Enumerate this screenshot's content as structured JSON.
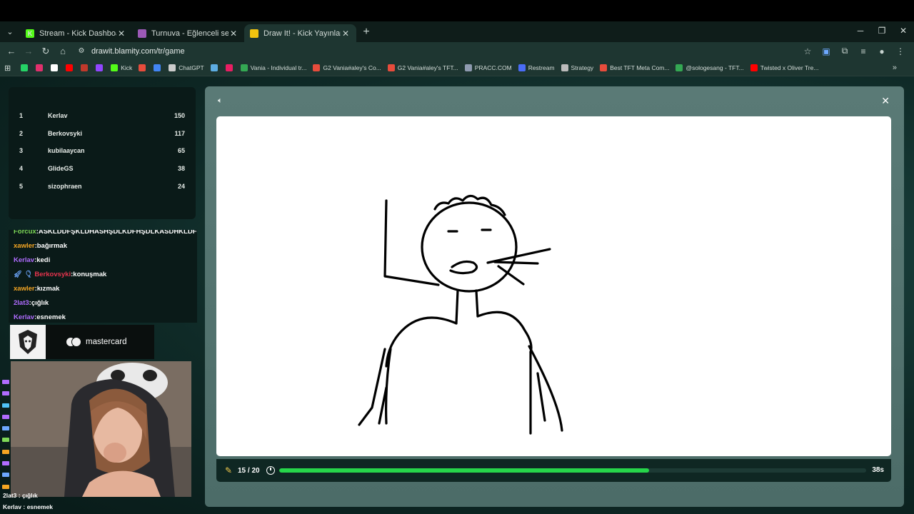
{
  "browser": {
    "tabs": [
      {
        "title": "Stream - Kick Dashboard",
        "active": false,
        "favicon_color": "#53fc18",
        "favicon_char": "K"
      },
      {
        "title": "Turnuva - Eğlenceli seçimler ya",
        "active": false,
        "favicon_color": "#9b59b6",
        "favicon_char": ""
      },
      {
        "title": "Draw It! - Kick Yayınları İçin Çiz",
        "active": true,
        "favicon_color": "#f1c40f",
        "favicon_char": ""
      }
    ],
    "url": "drawit.blamity.com/tr/game",
    "bookmarks": [
      {
        "label": "",
        "color": "#25d366"
      },
      {
        "label": "",
        "color": "#e1306c"
      },
      {
        "label": "",
        "color": "#ffffff"
      },
      {
        "label": "",
        "color": "#ff0000"
      },
      {
        "label": "",
        "color": "#c0392b"
      },
      {
        "label": "",
        "color": "#9146ff"
      },
      {
        "label": "Kick",
        "color": "#53fc18"
      },
      {
        "label": "",
        "color": "#e74c3c"
      },
      {
        "label": "",
        "color": "#4285f4"
      },
      {
        "label": "ChatGPT",
        "color": "#cccccc"
      },
      {
        "label": "",
        "color": "#5dade2"
      },
      {
        "label": "",
        "color": "#e91e63"
      },
      {
        "label": "Vania - Individual tr...",
        "color": "#34a853"
      },
      {
        "label": "G2 Vania#aley's Co...",
        "color": "#e74c3c"
      },
      {
        "label": "G2 Vania#aley's TFT...",
        "color": "#e74c3c"
      },
      {
        "label": "PRACC.COM",
        "color": "#8e9aaf"
      },
      {
        "label": "Restream",
        "color": "#4a6cf7"
      },
      {
        "label": "Strategy",
        "color": "#bbbbbb"
      },
      {
        "label": "Best TFT Meta Com...",
        "color": "#e74c3c"
      },
      {
        "label": "@sologesang - TFT...",
        "color": "#34a853"
      },
      {
        "label": "Twisted x Oliver Tre...",
        "color": "#ff0000"
      }
    ]
  },
  "leaderboard": [
    {
      "rank": "1",
      "name": "Kerlav",
      "score": "150"
    },
    {
      "rank": "2",
      "name": "Berkovsyki",
      "score": "117"
    },
    {
      "rank": "3",
      "name": "kubilaaycan",
      "score": "65"
    },
    {
      "rank": "4",
      "name": "GlideGS",
      "score": "38"
    },
    {
      "rank": "5",
      "name": "sizophraen",
      "score": "24"
    }
  ],
  "chat": [
    {
      "user": "Forcux",
      "sep": ":",
      "text": "ASKLDDFŞKLDHASHŞDLKDFHŞDLKASDHKLDF",
      "color": "#7ed957"
    },
    {
      "user": "xawler",
      "sep": ":",
      "text": "bağırmak",
      "color": "#f5a623"
    },
    {
      "user": "Kerlav",
      "sep": ":",
      "text": "kedi",
      "color": "#b06cff"
    },
    {
      "user": "Berkovsyki",
      "sep": ":",
      "text": "konuşmak",
      "color": "#e8344e"
    },
    {
      "user": "xawler",
      "sep": ":",
      "text": "kızmak",
      "color": "#f5a623"
    },
    {
      "user": "2lat3",
      "sep": ":",
      "text": "çığlık",
      "color": "#b06cff"
    },
    {
      "user": "Kerlav",
      "sep": ":",
      "text": "esnemek",
      "color": "#b06cff"
    }
  ],
  "sponsor": {
    "brand": "mastercard"
  },
  "bottom_chat": [
    {
      "user": "2lat3",
      "sep": " : ",
      "text": "çığlık"
    },
    {
      "user": "Kerlav",
      "sep": " : ",
      "text": "esnemek"
    }
  ],
  "game": {
    "round": "15 / 20",
    "time_left": "38s",
    "progress": 0.63
  }
}
